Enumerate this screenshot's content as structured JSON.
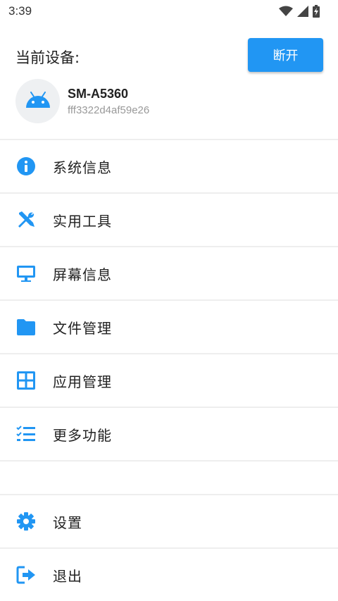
{
  "status_bar": {
    "time": "3:39",
    "icons": [
      "wifi-icon",
      "cell-signal-icon",
      "battery-charging-icon"
    ]
  },
  "device": {
    "label": "当前设备:",
    "disconnect_label": "断开",
    "model": "SM-A5360",
    "serial": "fff3322d4af59e26",
    "avatar_icon": "android-icon"
  },
  "menu": {
    "items": [
      {
        "label": "系统信息",
        "icon": "info-icon"
      },
      {
        "label": "实用工具",
        "icon": "tools-icon"
      },
      {
        "label": "屏幕信息",
        "icon": "monitor-icon"
      },
      {
        "label": "文件管理",
        "icon": "folder-icon"
      },
      {
        "label": "应用管理",
        "icon": "grid-icon"
      },
      {
        "label": "更多功能",
        "icon": "checklist-icon"
      }
    ],
    "bottom_items": [
      {
        "label": "设置",
        "icon": "gear-icon"
      },
      {
        "label": "退出",
        "icon": "logout-icon"
      }
    ]
  },
  "colors": {
    "accent": "#2196f3",
    "divider": "#eeeeee",
    "secondary_text": "#999999"
  }
}
